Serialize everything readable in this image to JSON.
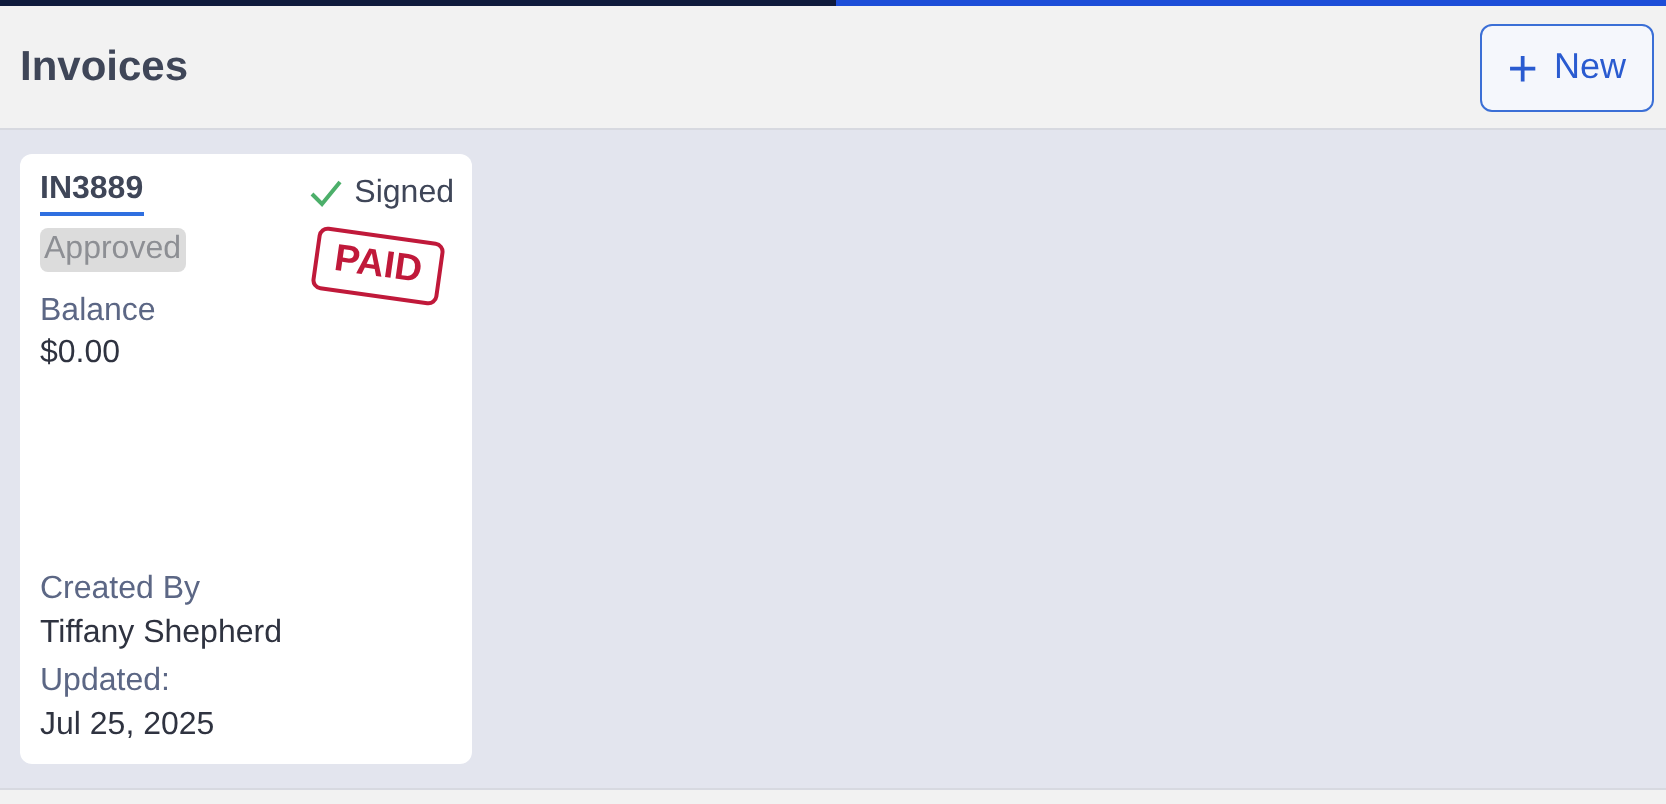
{
  "progress": {
    "level": 0.502
  },
  "header": {
    "title": "Invoices",
    "new_button": {
      "icon": "+",
      "label": "New"
    }
  },
  "invoices": [
    {
      "number": "IN3889",
      "signed": true,
      "signed_label": "Signed",
      "status": "Approved",
      "stamp": "PAID",
      "balance_label": "Balance",
      "balance": "$0.00",
      "created_by_label": "Created By",
      "created_by": "Tiffany Shepherd",
      "updated_label": "Updated:",
      "updated": "Jul 25, 2025"
    }
  ]
}
